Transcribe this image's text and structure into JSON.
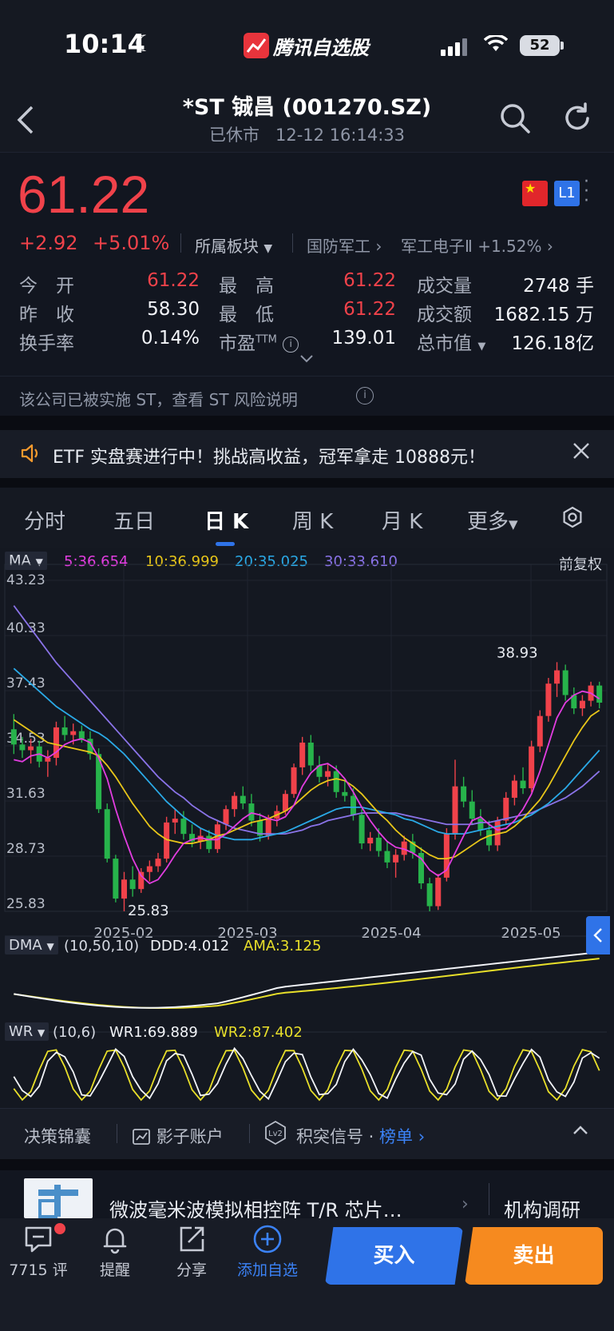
{
  "status_bar": {
    "time": "10:14",
    "app_name": "腾讯自选股",
    "battery": "52"
  },
  "header": {
    "title": "*ST 铖昌 (001270.SZ)",
    "status": "已休市   12-12 16:14:33"
  },
  "quote": {
    "price": "61.22",
    "change": "+2.92",
    "change_pct": "+5.01%",
    "sector_label": "所属板块",
    "industry": "国防军工",
    "subindustry": "军工电子Ⅱ +1.52%",
    "l1": "L1",
    "stats": [
      {
        "label": "今　开",
        "value": "61.22",
        "color": "red"
      },
      {
        "label": "最　高",
        "value": "61.22",
        "color": "red"
      },
      {
        "label": "成交量",
        "value": "2748 手",
        "color": "white"
      },
      {
        "label": "昨　收",
        "value": "58.30",
        "color": "white"
      },
      {
        "label": "最　低",
        "value": "61.22",
        "color": "red"
      },
      {
        "label": "成交额",
        "value": "1682.15 万",
        "color": "white"
      },
      {
        "label": "换手率",
        "value": "0.14%",
        "color": "white"
      },
      {
        "label": "市盈",
        "sup": "TTM",
        "value": "139.01",
        "color": "white"
      },
      {
        "label": "总市值",
        "value": "126.18亿",
        "color": "white"
      }
    ],
    "st_note": "该公司已被实施 ST，查看 ST 风险说明"
  },
  "banner": {
    "text": "ETF 实盘赛进行中！挑战高收益，冠军拿走 10888元！"
  },
  "tabs": [
    {
      "label": "分时",
      "active": false
    },
    {
      "label": "五日",
      "active": false
    },
    {
      "label": "日 K",
      "active": true
    },
    {
      "label": "周 K",
      "active": false
    },
    {
      "label": "月 K",
      "active": false
    },
    {
      "label": "更多",
      "active": false
    }
  ],
  "ma_legend": {
    "label": "MA",
    "items": [
      {
        "period": "5",
        "value": "36.654",
        "color": "#e23de0"
      },
      {
        "period": "10",
        "value": "36.999",
        "color": "#e8c619"
      },
      {
        "period": "20",
        "value": "35.025",
        "color": "#2aa9e6"
      },
      {
        "period": "30",
        "value": "33.610",
        "color": "#8a73e8"
      }
    ],
    "adjust": "前复权"
  },
  "chart_data": {
    "type": "candlestick",
    "y_ticks": [
      "43.23",
      "40.33",
      "37.43",
      "34.53",
      "31.63",
      "28.73",
      "25.83"
    ],
    "ylim": [
      25.83,
      43.23
    ],
    "x_ticks": [
      "2025-02",
      "2025-03",
      "2025-04",
      "2025-05"
    ],
    "max_label": "38.93",
    "min_label": "25.83",
    "colors": {
      "up": "#f0424a",
      "down": "#27b34b"
    },
    "candles": [
      [
        35.4,
        36.2,
        34.1,
        34.6
      ],
      [
        34.6,
        35.0,
        33.9,
        34.3
      ],
      [
        34.3,
        34.9,
        33.6,
        34.5
      ],
      [
        34.5,
        34.8,
        33.4,
        33.7
      ],
      [
        33.7,
        34.3,
        32.9,
        33.9
      ],
      [
        33.9,
        35.8,
        33.5,
        35.5
      ],
      [
        35.5,
        36.1,
        34.8,
        35.1
      ],
      [
        35.1,
        35.7,
        34.6,
        35.3
      ],
      [
        35.3,
        35.6,
        34.7,
        34.9
      ],
      [
        34.9,
        35.3,
        33.8,
        34.1
      ],
      [
        34.1,
        34.4,
        31.0,
        31.2
      ],
      [
        31.2,
        31.5,
        28.4,
        28.6
      ],
      [
        28.6,
        28.8,
        26.3,
        26.5
      ],
      [
        26.5,
        27.9,
        25.83,
        27.5
      ],
      [
        27.5,
        28.2,
        26.6,
        27.0
      ],
      [
        27.0,
        28.1,
        26.8,
        27.9
      ],
      [
        27.9,
        28.5,
        27.4,
        28.2
      ],
      [
        28.2,
        28.9,
        27.9,
        28.6
      ],
      [
        28.6,
        30.8,
        28.4,
        30.5
      ],
      [
        30.5,
        31.2,
        29.9,
        30.7
      ],
      [
        30.7,
        31.1,
        29.6,
        29.9
      ],
      [
        29.9,
        30.4,
        29.2,
        29.5
      ],
      [
        29.5,
        30.2,
        29.1,
        29.8
      ],
      [
        29.8,
        30.1,
        28.9,
        29.1
      ],
      [
        29.1,
        30.6,
        28.9,
        30.4
      ],
      [
        30.4,
        31.4,
        30.1,
        31.2
      ],
      [
        31.2,
        32.1,
        30.8,
        31.9
      ],
      [
        31.9,
        32.4,
        31.2,
        31.5
      ],
      [
        31.5,
        32.0,
        30.3,
        30.6
      ],
      [
        30.6,
        31.0,
        29.5,
        29.8
      ],
      [
        29.8,
        30.9,
        29.6,
        30.7
      ],
      [
        30.7,
        31.4,
        30.3,
        31.1
      ],
      [
        31.1,
        32.2,
        30.9,
        32.0
      ],
      [
        32.0,
        33.6,
        31.8,
        33.4
      ],
      [
        33.4,
        35.0,
        33.0,
        34.7
      ],
      [
        34.7,
        35.1,
        33.2,
        33.5
      ],
      [
        33.5,
        34.0,
        32.6,
        32.9
      ],
      [
        32.9,
        33.6,
        32.4,
        33.2
      ],
      [
        33.2,
        33.5,
        31.8,
        32.1
      ],
      [
        32.1,
        32.7,
        31.6,
        31.9
      ],
      [
        31.9,
        32.3,
        30.6,
        30.9
      ],
      [
        30.9,
        31.2,
        29.1,
        29.4
      ],
      [
        29.4,
        30.0,
        29.0,
        29.7
      ],
      [
        29.7,
        30.2,
        28.7,
        29.0
      ],
      [
        29.0,
        29.5,
        28.1,
        28.4
      ],
      [
        28.4,
        29.1,
        27.6,
        28.8
      ],
      [
        28.8,
        29.8,
        28.5,
        29.5
      ],
      [
        29.5,
        29.9,
        28.6,
        28.9
      ],
      [
        28.9,
        29.2,
        27.0,
        27.3
      ],
      [
        27.3,
        27.6,
        25.83,
        26.1
      ],
      [
        26.1,
        27.8,
        25.9,
        27.6
      ],
      [
        27.6,
        30.2,
        27.4,
        29.9
      ],
      [
        29.9,
        33.8,
        29.6,
        32.4
      ],
      [
        32.4,
        32.9,
        31.3,
        31.6
      ],
      [
        31.6,
        32.2,
        30.4,
        30.7
      ],
      [
        30.7,
        31.2,
        29.8,
        30.1
      ],
      [
        30.1,
        30.6,
        29.0,
        29.3
      ],
      [
        29.3,
        30.8,
        29.0,
        30.6
      ],
      [
        30.6,
        32.1,
        30.4,
        31.8
      ],
      [
        31.8,
        33.0,
        31.4,
        32.7
      ],
      [
        32.7,
        33.4,
        32.0,
        32.3
      ],
      [
        32.3,
        34.8,
        32.1,
        34.5
      ],
      [
        34.5,
        36.4,
        34.2,
        36.1
      ],
      [
        36.1,
        38.1,
        35.8,
        37.8
      ],
      [
        37.8,
        38.93,
        37.1,
        38.5
      ],
      [
        38.5,
        38.8,
        36.9,
        37.2
      ],
      [
        37.2,
        37.6,
        36.2,
        36.5
      ],
      [
        36.5,
        37.2,
        36.1,
        36.9
      ],
      [
        36.9,
        37.9,
        36.6,
        37.7
      ],
      [
        37.7,
        37.9,
        36.5,
        36.8
      ]
    ],
    "ma5": [
      33.8,
      33.7,
      34.0,
      34.1,
      33.9,
      34.2,
      34.6,
      34.8,
      34.9,
      34.7,
      33.9,
      32.8,
      31.2,
      29.8,
      28.6,
      27.7,
      27.3,
      27.5,
      28.1,
      28.8,
      29.4,
      29.6,
      29.7,
      29.6,
      29.6,
      29.9,
      30.3,
      30.7,
      31.0,
      30.9,
      30.7,
      30.6,
      30.8,
      31.4,
      32.4,
      33.1,
      33.5,
      33.6,
      33.3,
      32.8,
      32.1,
      31.3,
      30.6,
      30.0,
      29.5,
      29.2,
      29.1,
      28.9,
      28.6,
      28.0,
      27.7,
      28.0,
      28.9,
      29.8,
      30.6,
      30.8,
      30.4,
      30.1,
      30.2,
      30.6,
      31.2,
      32.0,
      33.2,
      34.6,
      36.0,
      36.8,
      37.2,
      37.4,
      37.3,
      37.0
    ],
    "ma10": [
      35.9,
      35.6,
      35.3,
      35.0,
      34.7,
      34.6,
      34.5,
      34.4,
      34.3,
      34.2,
      34.0,
      33.5,
      32.9,
      32.2,
      31.5,
      30.9,
      30.3,
      29.9,
      29.6,
      29.5,
      29.4,
      29.4,
      29.5,
      29.6,
      29.8,
      29.9,
      30.1,
      30.3,
      30.5,
      30.6,
      30.7,
      30.9,
      31.1,
      31.4,
      31.8,
      32.2,
      32.5,
      32.7,
      32.8,
      32.7,
      32.4,
      32.0,
      31.5,
      31.0,
      30.6,
      30.1,
      29.7,
      29.4,
      29.1,
      28.8,
      28.6,
      28.6,
      28.7,
      29.0,
      29.3,
      29.6,
      29.8,
      29.9,
      30.0,
      30.3,
      30.7,
      31.2,
      31.7,
      32.4,
      33.2,
      34.0,
      34.8,
      35.5,
      36.1,
      36.4
    ],
    "ma20": [
      38.6,
      38.2,
      37.8,
      37.4,
      37.0,
      36.6,
      36.3,
      36.0,
      35.7,
      35.4,
      35.2,
      34.9,
      34.5,
      34.1,
      33.6,
      33.1,
      32.6,
      32.1,
      31.6,
      31.2,
      30.8,
      30.5,
      30.2,
      30.0,
      29.8,
      29.7,
      29.6,
      29.6,
      29.6,
      29.7,
      29.8,
      29.9,
      30.0,
      30.2,
      30.4,
      30.6,
      30.8,
      31.0,
      31.2,
      31.3,
      31.3,
      31.3,
      31.2,
      31.1,
      31.0,
      30.9,
      30.7,
      30.6,
      30.4,
      30.2,
      30.0,
      29.9,
      29.9,
      29.9,
      30.0,
      30.1,
      30.2,
      30.3,
      30.4,
      30.5,
      30.7,
      30.9,
      31.2,
      31.5,
      31.9,
      32.3,
      32.8,
      33.3,
      33.8,
      34.3
    ],
    "ma30": [
      41.9,
      41.3,
      40.7,
      40.1,
      39.5,
      38.9,
      38.4,
      37.9,
      37.4,
      36.9,
      36.4,
      35.9,
      35.4,
      34.9,
      34.4,
      33.9,
      33.4,
      32.9,
      32.5,
      32.1,
      31.8,
      31.4,
      31.1,
      30.8,
      30.6,
      30.4,
      30.2,
      30.1,
      30.0,
      29.9,
      29.9,
      29.9,
      29.9,
      30.0,
      30.1,
      30.3,
      30.4,
      30.6,
      30.7,
      30.8,
      30.9,
      31.0,
      31.0,
      31.0,
      31.0,
      31.0,
      30.9,
      30.8,
      30.7,
      30.6,
      30.5,
      30.4,
      30.4,
      30.4,
      30.4,
      30.5,
      30.5,
      30.6,
      30.7,
      30.8,
      30.9,
      31.0,
      31.2,
      31.4,
      31.6,
      31.8,
      32.1,
      32.4,
      32.8,
      33.2
    ]
  },
  "dma": {
    "label": "DMA",
    "params": "(10,50,10)",
    "ddd": "DDD:4.012",
    "ama": "AMA:3.125"
  },
  "wr": {
    "label": "WR",
    "params": "(10,6)",
    "wr1": "WR1:69.889",
    "wr2": "WR2:87.402"
  },
  "decision_bar": {
    "item1": "决策锦囊",
    "item2": "影子账户",
    "item3": "积突信号 ·",
    "item3_link": "榜单",
    "lv2": "Lv2"
  },
  "news": {
    "title": "微波毫米波模拟相控阵 T/R 芯片…",
    "tag": "机构调研"
  },
  "bottom_nav": {
    "comment": "7715 评",
    "alert": "提醒",
    "share": "分享",
    "add_watch": "添加自选",
    "buy": "买入",
    "sell": "卖出"
  }
}
